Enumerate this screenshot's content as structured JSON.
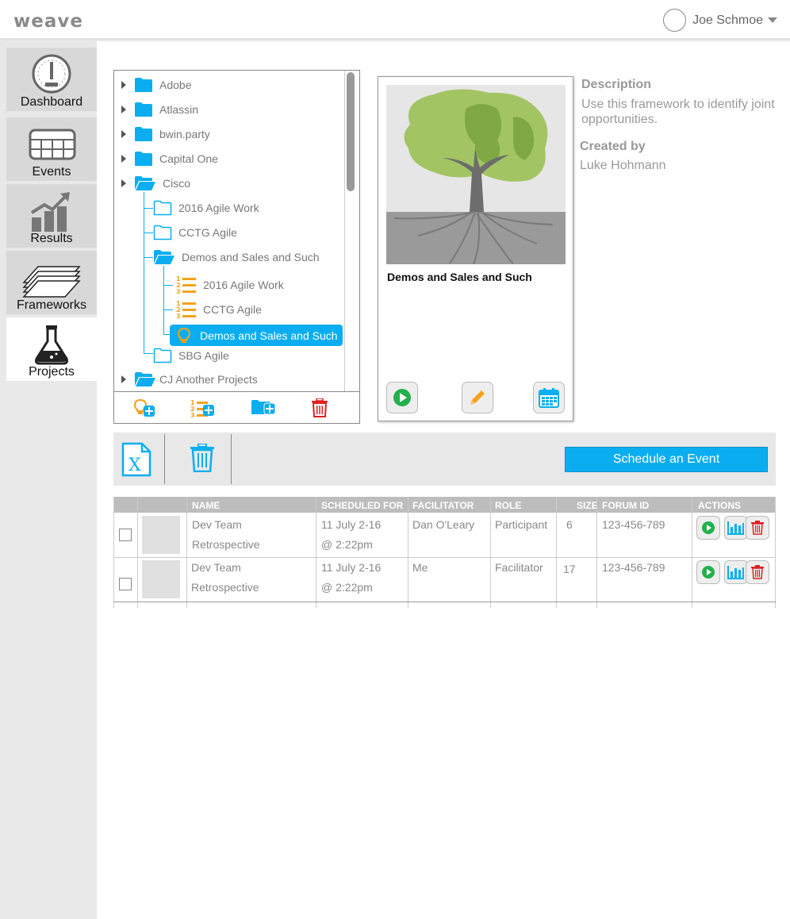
{
  "app": {
    "logo": "weave"
  },
  "user": {
    "name": "Joe Schmoe"
  },
  "nav": [
    {
      "label": "Dashboard",
      "icon": "gauge-icon"
    },
    {
      "label": "Events",
      "icon": "calendar-grid-icon"
    },
    {
      "label": "Results",
      "icon": "bar-chart-trend-icon"
    },
    {
      "label": "Frameworks",
      "icon": "stacked-papers-icon"
    },
    {
      "label": "Projects",
      "icon": "flask-icon",
      "active": true
    }
  ],
  "tree": {
    "items": [
      {
        "label": "Adobe"
      },
      {
        "label": "Atlassin"
      },
      {
        "label": "bwin.party"
      },
      {
        "label": "Capital One"
      },
      {
        "label": "Cisco"
      },
      {
        "label": "2016 Agile Work"
      },
      {
        "label": "CCTG Agile"
      },
      {
        "label": "Demos and Sales and Such"
      },
      {
        "label": "2016 Agile Work"
      },
      {
        "label": "CCTG Agile"
      },
      {
        "label": "Demos and Sales and Such",
        "selected": true
      },
      {
        "label": "SBG Agile"
      },
      {
        "label": "CJ Another Projects"
      }
    ],
    "toolbar": [
      "add-idea-icon",
      "add-list-icon",
      "add-folder-icon",
      "trash-icon"
    ]
  },
  "card": {
    "title": "Demos and Sales and Such"
  },
  "details": {
    "description_heading": "Description",
    "description": "Use this framework to identify joint opportunities.",
    "created_by_heading": "Created by",
    "created_by": "Luke Hohmann"
  },
  "actions": {
    "schedule_label": "Schedule an Event"
  },
  "table": {
    "headers": [
      "NAME",
      "SCHEDULED FOR",
      "FACILITATOR",
      "ROLE",
      "SIZE",
      "FORUM ID",
      "ACTIONS"
    ],
    "rows": [
      {
        "name1": "Dev Team",
        "name2": "Retrospective",
        "date1": "11 July 2-16",
        "date2": "@ 2:22pm",
        "facilitator": "Dan O'Leary",
        "role": "Participant",
        "size": "6",
        "forum_id": "123-456-789"
      },
      {
        "name1": "Dev Team",
        "name2": "Retrospective",
        "date1": "11 July 2-16",
        "date2": "@ 2:22pm",
        "facilitator": "Me",
        "role": "Facilitator",
        "size": "17",
        "forum_id": "123-456-789"
      }
    ]
  },
  "colors": {
    "accent": "#0aaef0",
    "orange": "#f5a11c",
    "green": "#22b14c",
    "red": "#e02020"
  }
}
